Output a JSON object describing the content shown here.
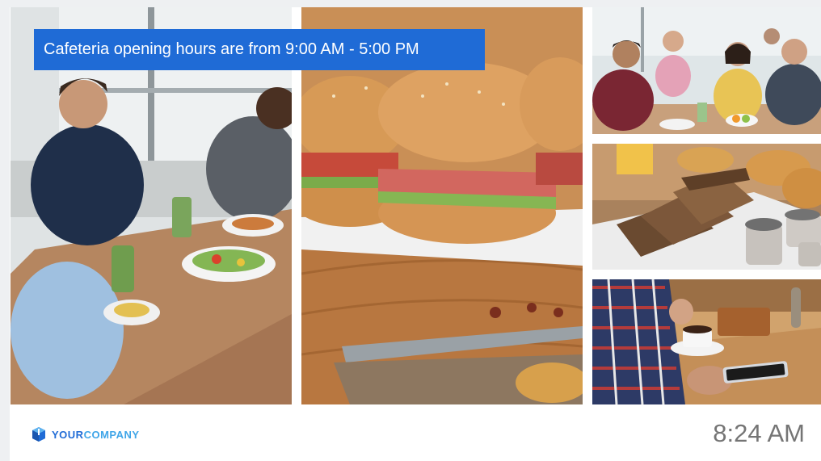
{
  "banner": {
    "text": "Cafeteria opening hours are from 9:00 AM - 5:00 PM"
  },
  "footer": {
    "logo_your": "YOUR",
    "logo_company": "COMPANY",
    "time": "8:24 AM"
  },
  "colors": {
    "banner_bg": "#1f6bd6",
    "logo_primary": "#1f6bd6",
    "logo_secondary": "#3fa5e8",
    "clock_text": "#757575"
  },
  "icons": {
    "logo": "cube-logo-icon"
  }
}
